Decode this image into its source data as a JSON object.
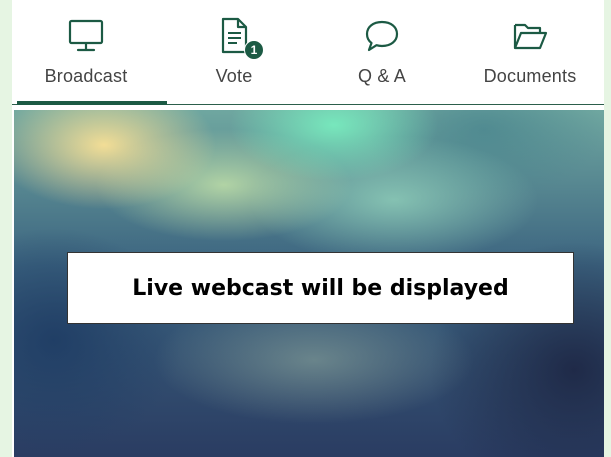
{
  "tabs": [
    {
      "label": "Broadcast",
      "icon": "monitor-icon",
      "active": true
    },
    {
      "label": "Vote",
      "icon": "document-icon",
      "badge": "1"
    },
    {
      "label": "Q & A",
      "icon": "speech-bubble-icon"
    },
    {
      "label": "Documents",
      "icon": "folder-icon"
    }
  ],
  "video": {
    "placeholder": "Live webcast will be displayed"
  },
  "colors": {
    "accent": "#1c5a44",
    "frame_background": "#e6f5e3"
  }
}
